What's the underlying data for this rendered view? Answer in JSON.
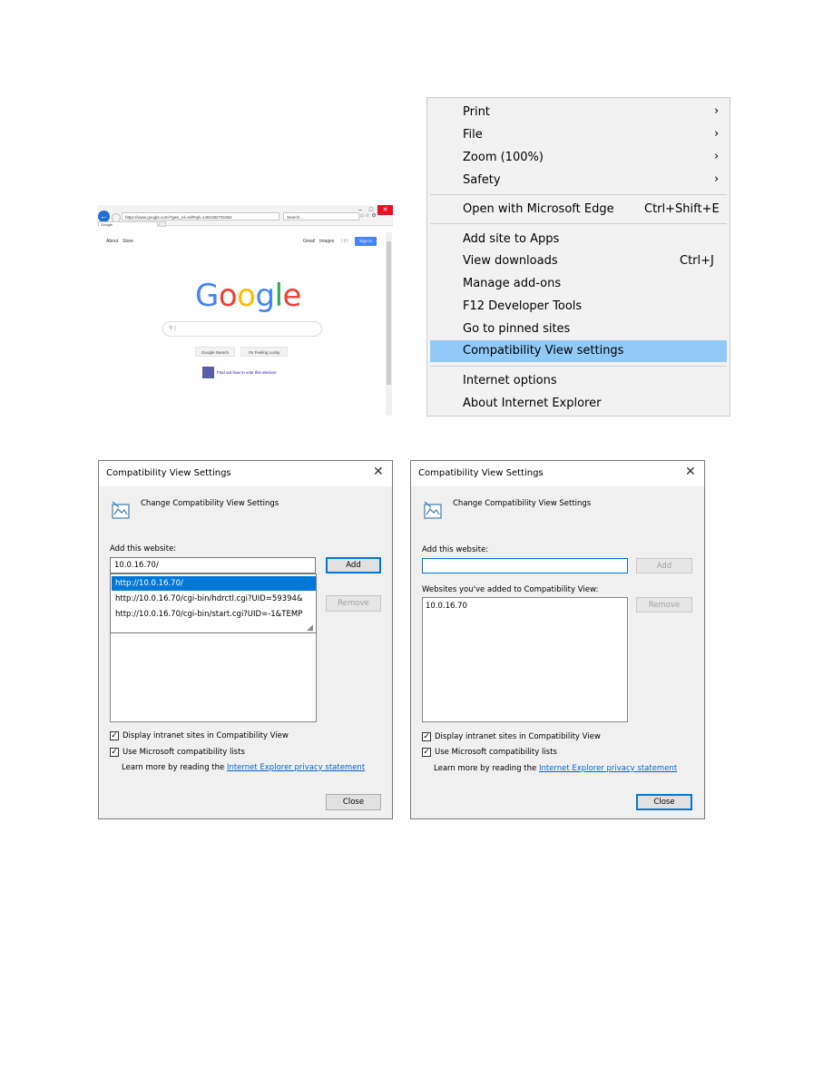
{
  "browser": {
    "address": "https://www.google.com/?gws_rd=ssl#spf=1481082781864",
    "search_placeholder": "Search...",
    "tab_title": "Google",
    "nav_left": [
      "About",
      "Store"
    ],
    "nav_right": [
      "Gmail",
      "Images"
    ],
    "signin_label": "Sign in",
    "logo": [
      "G",
      "o",
      "o",
      "g",
      "l",
      "e"
    ],
    "logo_colors": [
      "#4285f4",
      "#ea4335",
      "#fbbc05",
      "#4285f4",
      "#34a853",
      "#ea4335"
    ],
    "search_button": "Google Search",
    "lucky_button": "I'm Feeling Lucky",
    "vote_text": "Find out how to vote this election"
  },
  "menu": {
    "items": [
      {
        "label": "Print",
        "arrow": "›"
      },
      {
        "label": "File",
        "arrow": "›"
      },
      {
        "label": "Zoom (100%)",
        "arrow": "›"
      },
      {
        "label": "Safety",
        "arrow": "›"
      },
      {
        "label": "Open with Microsoft Edge",
        "shortcut": "Ctrl+Shift+E"
      },
      {
        "label": "Add site to Apps"
      },
      {
        "label": "View downloads",
        "shortcut": "Ctrl+J"
      },
      {
        "label": "Manage add-ons"
      },
      {
        "label": "F12 Developer Tools"
      },
      {
        "label": "Go to pinned sites"
      },
      {
        "label": "Compatibility View settings",
        "highlighted": true
      },
      {
        "label": "Internet options"
      },
      {
        "label": "About Internet Explorer"
      }
    ],
    "highlight_color": "#91c9f7"
  },
  "dialog_left": {
    "title": "Compatibility View Settings",
    "close_glyph": "✕",
    "heading": "Change Compatibility View Settings",
    "add_label": "Add this website:",
    "input_value": "10.0.16.70/",
    "add_button": "Add",
    "remove_button": "Remove",
    "suggestions": [
      "http://10.0.16.70/",
      "http://10.0.16.70/cgi-bin/hdrctl.cgi?UID=59394&",
      "http://10.0.16.70/cgi-bin/start.cgi?UID=-1&TEMP"
    ],
    "check_intranet": "Display intranet sites in Compatibility View",
    "check_lists": "Use Microsoft compatibility lists",
    "learn_prefix": "Learn more by reading the",
    "learn_link": "Internet Explorer privacy statement",
    "close_button": "Close"
  },
  "dialog_right": {
    "title": "Compatibility View Settings",
    "close_glyph": "✕",
    "heading": "Change Compatibility View Settings",
    "add_label": "Add this website:",
    "input_value": "",
    "add_button": "Add",
    "sites_label": "Websites you've added to Compatibility View:",
    "sites": [
      "10.0.16.70"
    ],
    "remove_button": "Remove",
    "check_intranet": "Display intranet sites in Compatibility View",
    "check_lists": "Use Microsoft compatibility lists",
    "learn_prefix": "Learn more by reading the",
    "learn_link": "Internet Explorer privacy statement",
    "close_button": "Close"
  }
}
